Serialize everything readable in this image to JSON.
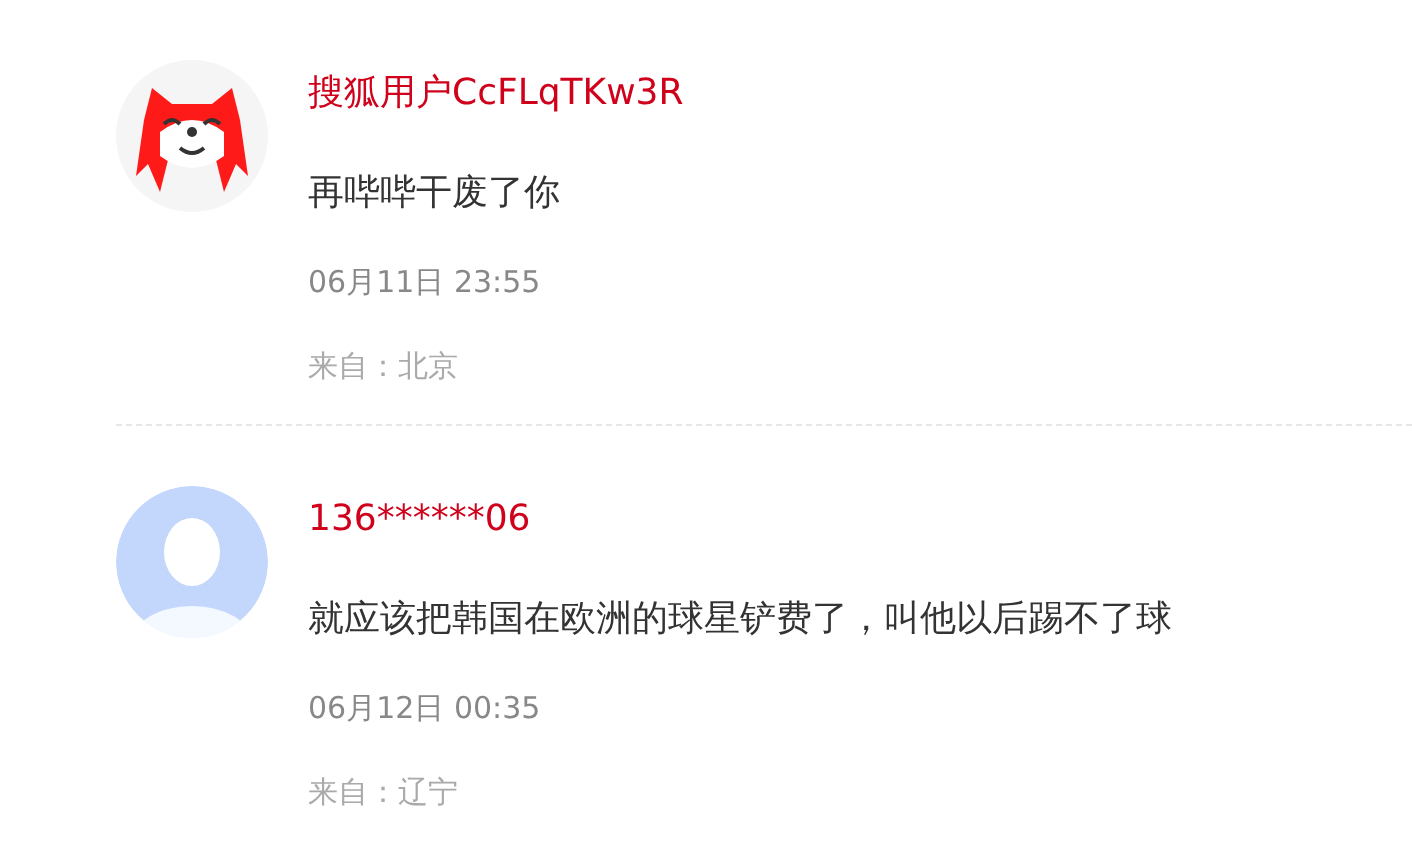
{
  "comments": [
    {
      "avatar": {
        "kind": "fox"
      },
      "user": "搜狐用户CcFLqTKw3R",
      "content": "再哔哔干废了你",
      "time": "06月11日 23:55",
      "location": "来自：北京"
    },
    {
      "avatar": {
        "kind": "default"
      },
      "user": "136******06",
      "content": "就应该把韩国在欧洲的球星铲费了，叫他以后踢不了球",
      "time": "06月12日 00:35",
      "location": "来自：辽宁"
    }
  ]
}
